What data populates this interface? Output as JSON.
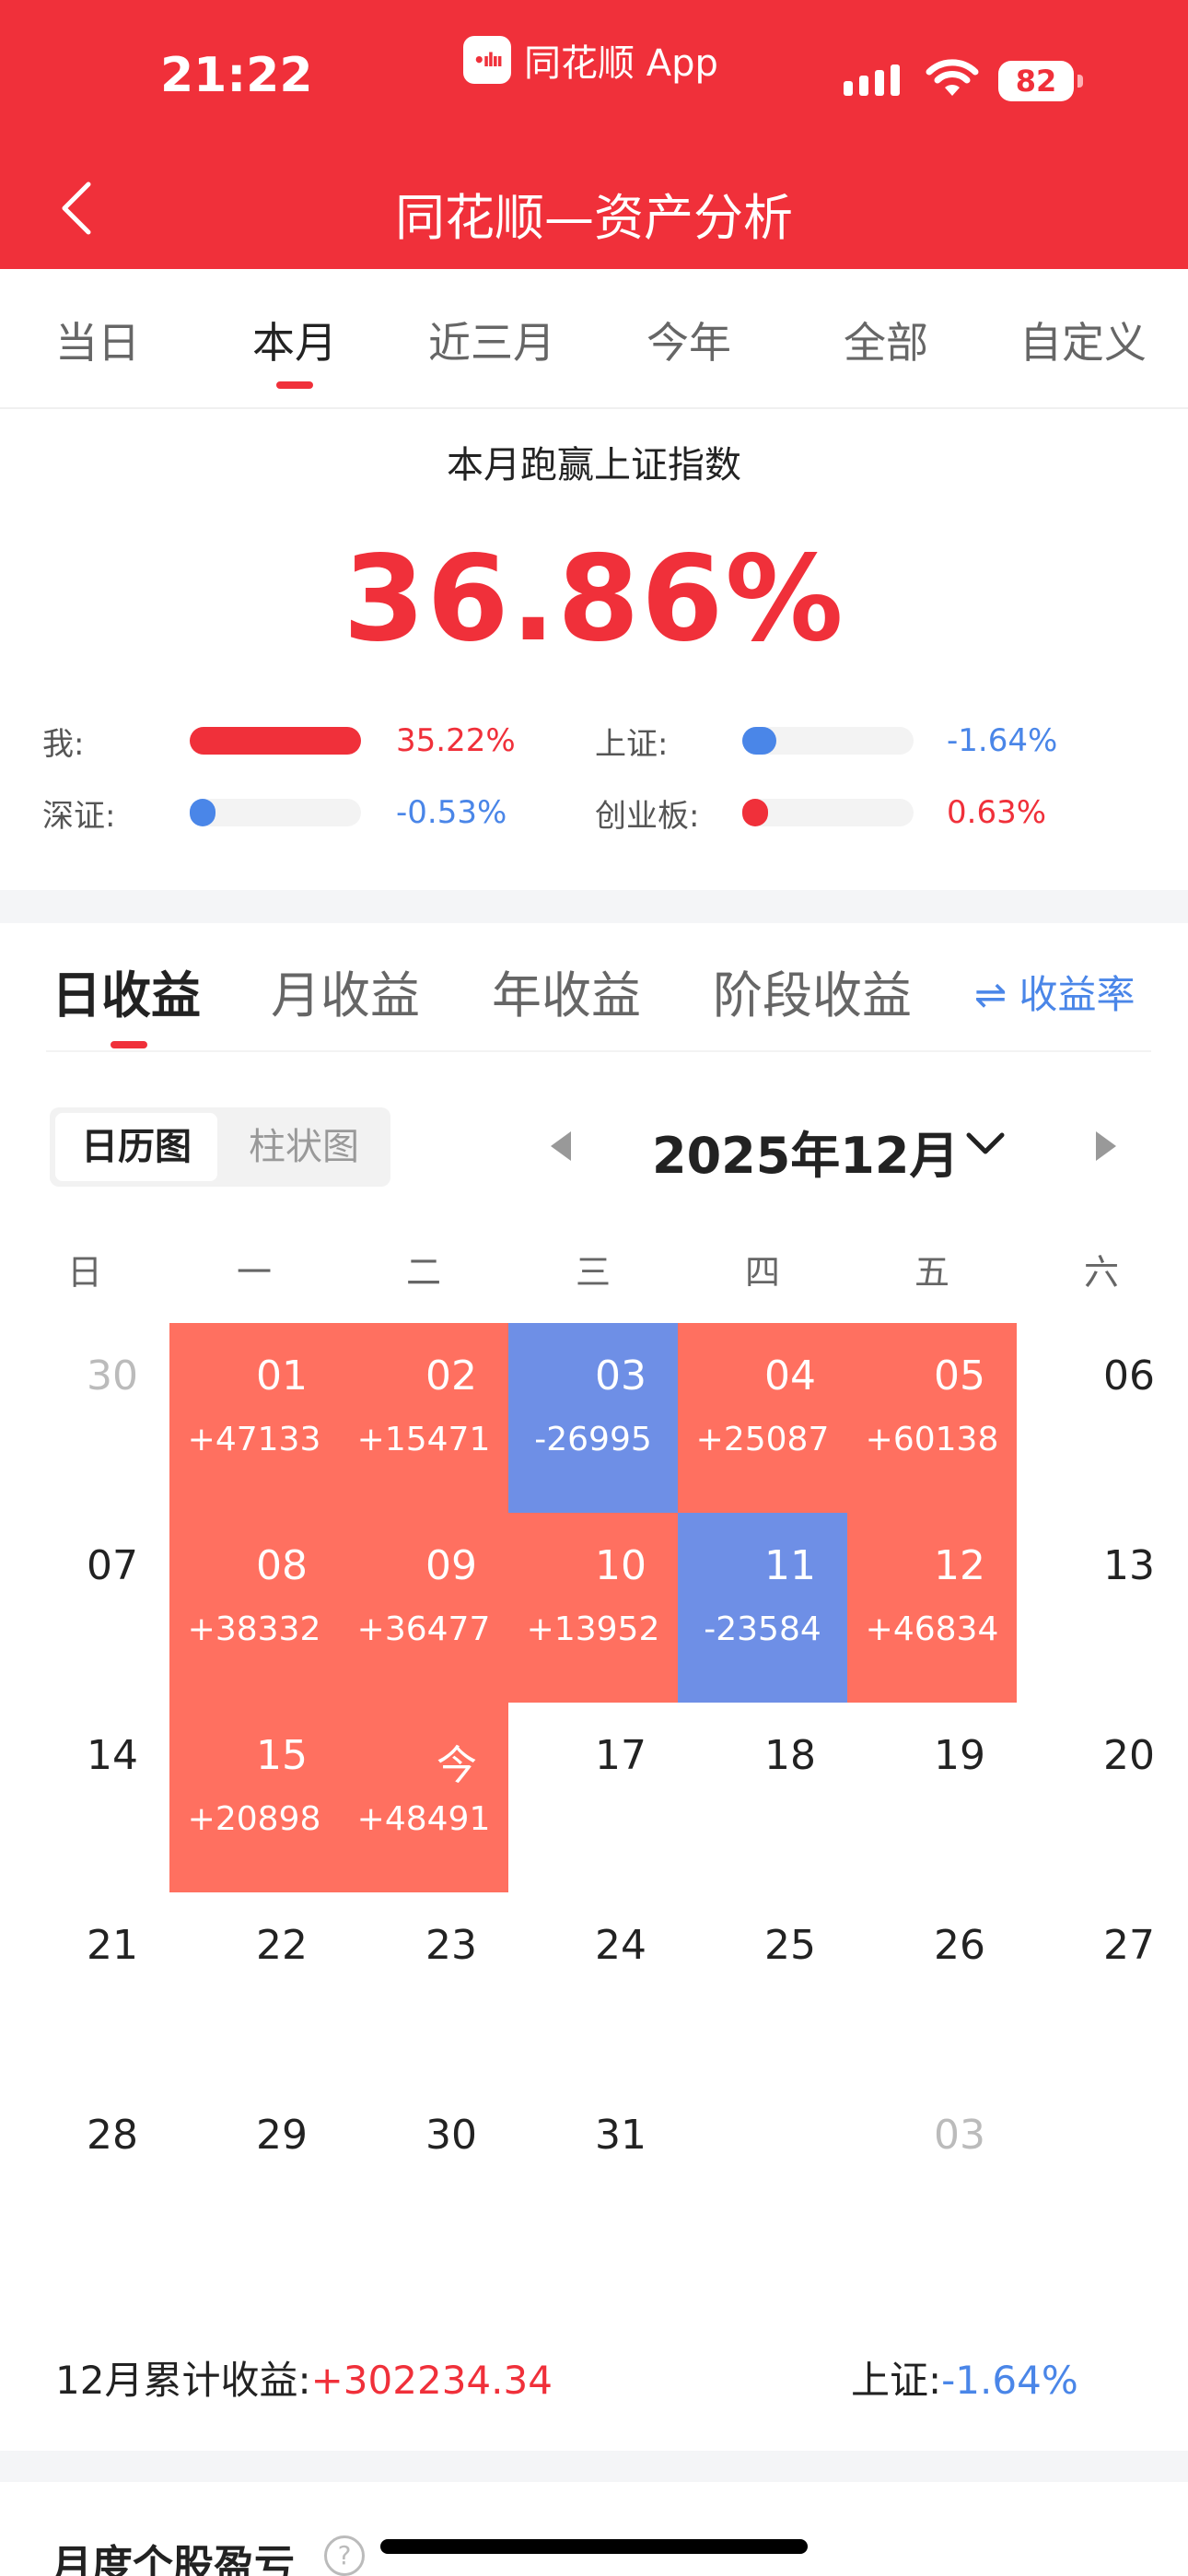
{
  "status": {
    "time": "21:22",
    "app": "同花顺 App",
    "battery": "82"
  },
  "header": {
    "title": "同花顺—资产分析"
  },
  "period_tabs": [
    "当日",
    "本月",
    "近三月",
    "今年",
    "全部",
    "自定义"
  ],
  "summary": {
    "label": "本月跑赢上证指数",
    "value": "36.86%",
    "compare": [
      {
        "label": "我:",
        "value": "35.22%",
        "fraction": 1.0,
        "color": "#f0303a"
      },
      {
        "label": "上证:",
        "value": "-1.64%",
        "fraction": 0.2,
        "color": "#4a86e8"
      },
      {
        "label": "深证:",
        "value": "-0.53%",
        "fraction": 0.15,
        "color": "#4a86e8"
      },
      {
        "label": "创业板:",
        "value": "0.63%",
        "fraction": 0.15,
        "color": "#f0303a"
      }
    ]
  },
  "earnings_tabs": [
    "日收益",
    "月收益",
    "年收益",
    "阶段收益"
  ],
  "earnings_rate": "⇌ 收益率",
  "view_toggle": [
    "日历图",
    "柱状图"
  ],
  "month": "2025年12月",
  "weekdays": [
    "日",
    "一",
    "二",
    "三",
    "四",
    "五",
    "六"
  ],
  "calendar": [
    [
      {
        "d": "30",
        "t": "other"
      },
      {
        "d": "01",
        "p": "+47133",
        "t": "gain"
      },
      {
        "d": "02",
        "p": "+15471",
        "t": "gain"
      },
      {
        "d": "03",
        "p": "-26995",
        "t": "loss"
      },
      {
        "d": "04",
        "p": "+25087",
        "t": "gain"
      },
      {
        "d": "05",
        "p": "+60138",
        "t": "gain"
      },
      {
        "d": "06",
        "t": "normal"
      }
    ],
    [
      {
        "d": "07",
        "t": "normal"
      },
      {
        "d": "08",
        "p": "+38332",
        "t": "gain"
      },
      {
        "d": "09",
        "p": "+36477",
        "t": "gain"
      },
      {
        "d": "10",
        "p": "+13952",
        "t": "gain"
      },
      {
        "d": "11",
        "p": "-23584",
        "t": "loss"
      },
      {
        "d": "12",
        "p": "+46834",
        "t": "gain"
      },
      {
        "d": "13",
        "t": "normal"
      }
    ],
    [
      {
        "d": "14",
        "t": "normal"
      },
      {
        "d": "15",
        "p": "+20898",
        "t": "gain"
      },
      {
        "d": "今",
        "p": "+48491",
        "t": "gain"
      },
      {
        "d": "17",
        "t": "normal"
      },
      {
        "d": "18",
        "t": "normal"
      },
      {
        "d": "19",
        "t": "normal"
      },
      {
        "d": "20",
        "t": "normal"
      }
    ],
    [
      {
        "d": "21",
        "t": "normal"
      },
      {
        "d": "22",
        "t": "normal"
      },
      {
        "d": "23",
        "t": "normal"
      },
      {
        "d": "24",
        "t": "normal"
      },
      {
        "d": "25",
        "t": "normal"
      },
      {
        "d": "26",
        "t": "normal"
      },
      {
        "d": "27",
        "t": "normal"
      }
    ],
    [
      {
        "d": "28",
        "t": "normal"
      },
      {
        "d": "29",
        "t": "normal"
      },
      {
        "d": "30",
        "t": "normal"
      },
      {
        "d": "31",
        "t": "normal"
      },
      {
        "d": "",
        "t": "empty"
      },
      {
        "d": "03",
        "t": "other"
      },
      {
        "d": "",
        "t": "empty"
      }
    ]
  ],
  "footer": {
    "month_total_label": "12月累计收益:",
    "month_total_value": "+302234.34",
    "index_label": "上证:",
    "index_value": "-1.64%"
  },
  "next_section": "月度个股盈亏",
  "help_icon": "?"
}
